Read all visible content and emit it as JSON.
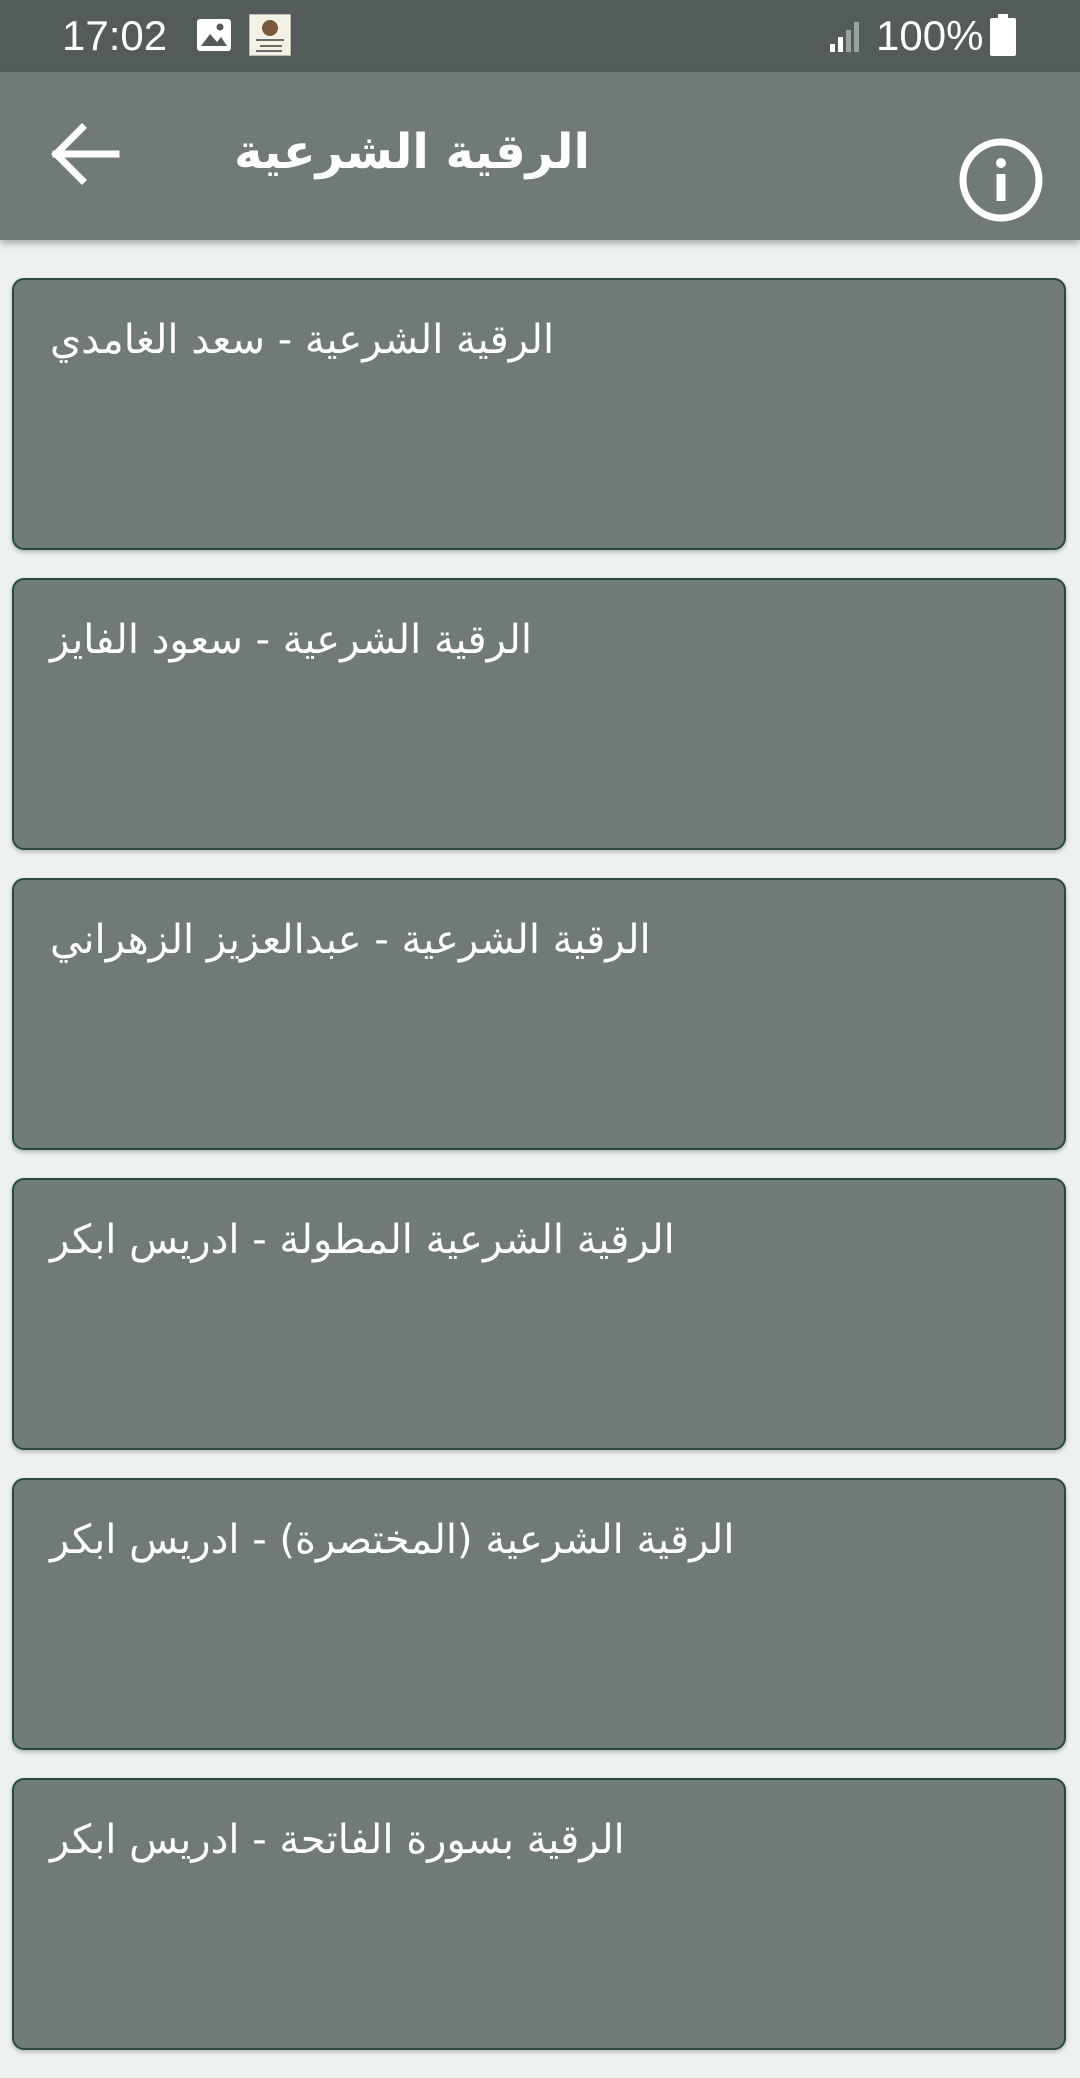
{
  "status_bar": {
    "time": "17:02",
    "battery": "100%",
    "icons": [
      "image-icon",
      "app-notification-icon",
      "signal-icon",
      "battery-icon"
    ]
  },
  "app_bar": {
    "title": "الرقية الشرعية",
    "back_icon": "arrow-back-icon",
    "info_icon": "info-icon",
    "background": "#707a78"
  },
  "colors": {
    "status_bar": "#535c5b",
    "card": "#707a78",
    "card_border": "#264a3e",
    "page_background": "#eef1f1",
    "text": "#ffffff"
  },
  "list": {
    "items": [
      {
        "label": "الرقية الشرعية - سعد الغامدي"
      },
      {
        "label": "الرقية الشرعية - سعود الفايز"
      },
      {
        "label": "الرقية الشرعية - عبدالعزيز الزهراني"
      },
      {
        "label": "الرقية الشرعية المطولة - ادريس ابكر"
      },
      {
        "label": "الرقية الشرعية (المختصرة) - ادريس ابكر"
      },
      {
        "label": "الرقية بسورة الفاتحة - ادريس ابكر"
      }
    ]
  }
}
